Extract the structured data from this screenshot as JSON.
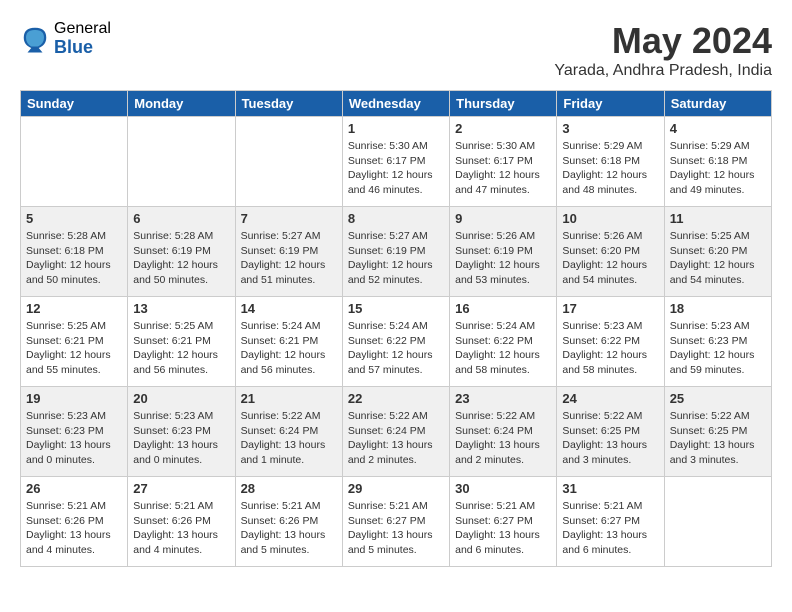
{
  "logo": {
    "general": "General",
    "blue": "Blue"
  },
  "title": "May 2024",
  "location": "Yarada, Andhra Pradesh, India",
  "days_header": [
    "Sunday",
    "Monday",
    "Tuesday",
    "Wednesday",
    "Thursday",
    "Friday",
    "Saturday"
  ],
  "weeks": [
    [
      {
        "day": "",
        "info": ""
      },
      {
        "day": "",
        "info": ""
      },
      {
        "day": "",
        "info": ""
      },
      {
        "day": "1",
        "info": "Sunrise: 5:30 AM\nSunset: 6:17 PM\nDaylight: 12 hours\nand 46 minutes."
      },
      {
        "day": "2",
        "info": "Sunrise: 5:30 AM\nSunset: 6:17 PM\nDaylight: 12 hours\nand 47 minutes."
      },
      {
        "day": "3",
        "info": "Sunrise: 5:29 AM\nSunset: 6:18 PM\nDaylight: 12 hours\nand 48 minutes."
      },
      {
        "day": "4",
        "info": "Sunrise: 5:29 AM\nSunset: 6:18 PM\nDaylight: 12 hours\nand 49 minutes."
      }
    ],
    [
      {
        "day": "5",
        "info": "Sunrise: 5:28 AM\nSunset: 6:18 PM\nDaylight: 12 hours\nand 50 minutes."
      },
      {
        "day": "6",
        "info": "Sunrise: 5:28 AM\nSunset: 6:19 PM\nDaylight: 12 hours\nand 50 minutes."
      },
      {
        "day": "7",
        "info": "Sunrise: 5:27 AM\nSunset: 6:19 PM\nDaylight: 12 hours\nand 51 minutes."
      },
      {
        "day": "8",
        "info": "Sunrise: 5:27 AM\nSunset: 6:19 PM\nDaylight: 12 hours\nand 52 minutes."
      },
      {
        "day": "9",
        "info": "Sunrise: 5:26 AM\nSunset: 6:19 PM\nDaylight: 12 hours\nand 53 minutes."
      },
      {
        "day": "10",
        "info": "Sunrise: 5:26 AM\nSunset: 6:20 PM\nDaylight: 12 hours\nand 54 minutes."
      },
      {
        "day": "11",
        "info": "Sunrise: 5:25 AM\nSunset: 6:20 PM\nDaylight: 12 hours\nand 54 minutes."
      }
    ],
    [
      {
        "day": "12",
        "info": "Sunrise: 5:25 AM\nSunset: 6:21 PM\nDaylight: 12 hours\nand 55 minutes."
      },
      {
        "day": "13",
        "info": "Sunrise: 5:25 AM\nSunset: 6:21 PM\nDaylight: 12 hours\nand 56 minutes."
      },
      {
        "day": "14",
        "info": "Sunrise: 5:24 AM\nSunset: 6:21 PM\nDaylight: 12 hours\nand 56 minutes."
      },
      {
        "day": "15",
        "info": "Sunrise: 5:24 AM\nSunset: 6:22 PM\nDaylight: 12 hours\nand 57 minutes."
      },
      {
        "day": "16",
        "info": "Sunrise: 5:24 AM\nSunset: 6:22 PM\nDaylight: 12 hours\nand 58 minutes."
      },
      {
        "day": "17",
        "info": "Sunrise: 5:23 AM\nSunset: 6:22 PM\nDaylight: 12 hours\nand 58 minutes."
      },
      {
        "day": "18",
        "info": "Sunrise: 5:23 AM\nSunset: 6:23 PM\nDaylight: 12 hours\nand 59 minutes."
      }
    ],
    [
      {
        "day": "19",
        "info": "Sunrise: 5:23 AM\nSunset: 6:23 PM\nDaylight: 13 hours\nand 0 minutes."
      },
      {
        "day": "20",
        "info": "Sunrise: 5:23 AM\nSunset: 6:23 PM\nDaylight: 13 hours\nand 0 minutes."
      },
      {
        "day": "21",
        "info": "Sunrise: 5:22 AM\nSunset: 6:24 PM\nDaylight: 13 hours\nand 1 minute."
      },
      {
        "day": "22",
        "info": "Sunrise: 5:22 AM\nSunset: 6:24 PM\nDaylight: 13 hours\nand 2 minutes."
      },
      {
        "day": "23",
        "info": "Sunrise: 5:22 AM\nSunset: 6:24 PM\nDaylight: 13 hours\nand 2 minutes."
      },
      {
        "day": "24",
        "info": "Sunrise: 5:22 AM\nSunset: 6:25 PM\nDaylight: 13 hours\nand 3 minutes."
      },
      {
        "day": "25",
        "info": "Sunrise: 5:22 AM\nSunset: 6:25 PM\nDaylight: 13 hours\nand 3 minutes."
      }
    ],
    [
      {
        "day": "26",
        "info": "Sunrise: 5:21 AM\nSunset: 6:26 PM\nDaylight: 13 hours\nand 4 minutes."
      },
      {
        "day": "27",
        "info": "Sunrise: 5:21 AM\nSunset: 6:26 PM\nDaylight: 13 hours\nand 4 minutes."
      },
      {
        "day": "28",
        "info": "Sunrise: 5:21 AM\nSunset: 6:26 PM\nDaylight: 13 hours\nand 5 minutes."
      },
      {
        "day": "29",
        "info": "Sunrise: 5:21 AM\nSunset: 6:27 PM\nDaylight: 13 hours\nand 5 minutes."
      },
      {
        "day": "30",
        "info": "Sunrise: 5:21 AM\nSunset: 6:27 PM\nDaylight: 13 hours\nand 6 minutes."
      },
      {
        "day": "31",
        "info": "Sunrise: 5:21 AM\nSunset: 6:27 PM\nDaylight: 13 hours\nand 6 minutes."
      },
      {
        "day": "",
        "info": ""
      }
    ]
  ]
}
